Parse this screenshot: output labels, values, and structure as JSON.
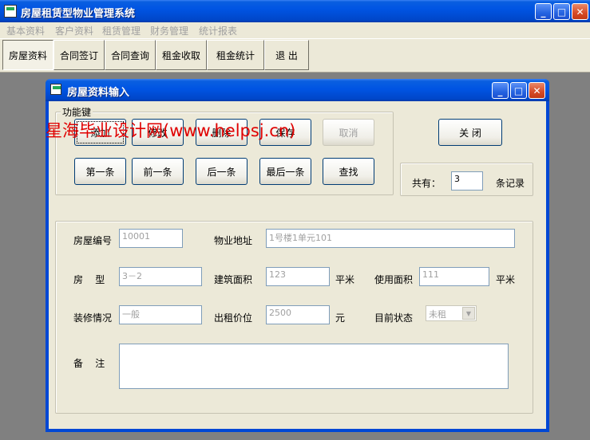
{
  "app": {
    "title": "房屋租赁型物业管理系统",
    "controls": {
      "minimize": "_",
      "maximize": "□",
      "close": "✕"
    }
  },
  "menu": [
    "基本资料",
    "客户资料",
    "租赁管理",
    "财务管理",
    "统计报表"
  ],
  "toolbar": [
    "房屋资料",
    "合同签订",
    "合同查询",
    "租金收取",
    "租金统计",
    "退 出"
  ],
  "child": {
    "title": "房屋资料输入",
    "group_label": "功能键",
    "func_row1": [
      "添加",
      "修改",
      "删除",
      "保存",
      "取消"
    ],
    "func_row2": [
      "第一条",
      "前一条",
      "后一条",
      "最后一条",
      "查找"
    ],
    "close_label": "关  闭",
    "count": {
      "prefix": "共有：",
      "value": "3",
      "suffix": "条记录"
    },
    "fields": {
      "house_no_label": "房屋编号",
      "house_no": "10001",
      "address_label": "物业地址",
      "address": "1号楼1单元101",
      "type_label": "房    型",
      "type": "3－2",
      "build_area_label": "建筑面积",
      "build_area": "123",
      "build_unit": "平米",
      "use_area_label": "使用面积",
      "use_area": "111",
      "use_unit": "平米",
      "decor_label": "装修情况",
      "decor": "一般",
      "price_label": "出租价位",
      "price": "2500",
      "price_unit": "元",
      "status_label": "目前状态",
      "status": "未租",
      "remark_label": "备    注",
      "remark": ""
    }
  },
  "watermark": "星海毕业设计网(www.helpsj.cn)"
}
